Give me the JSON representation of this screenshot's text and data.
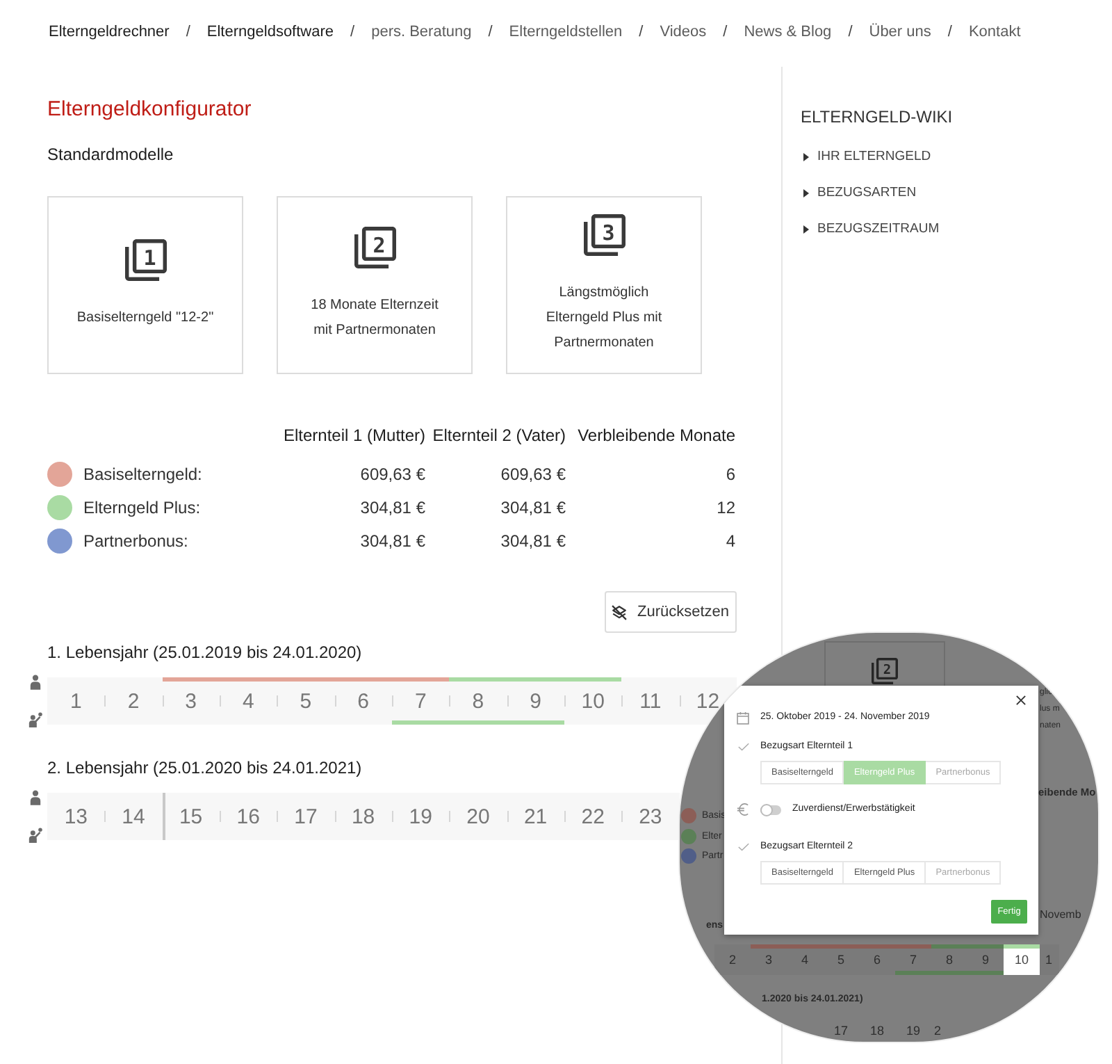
{
  "nav": [
    {
      "label": "Elterngeldrechner",
      "active": true,
      "separator": "/"
    },
    {
      "label": "Elterngeldsoftware",
      "active": true,
      "separator": "/"
    },
    {
      "label": "pers. Beratung",
      "active": false,
      "separator": "/"
    },
    {
      "label": "Elterngeldstellen",
      "active": false,
      "separator": "/"
    },
    {
      "label": "Videos",
      "active": false,
      "separator": "/"
    },
    {
      "label": "News & Blog",
      "active": false,
      "separator": "/"
    },
    {
      "label": "Über uns",
      "active": false,
      "separator": "/"
    },
    {
      "label": "Kontakt",
      "active": false
    }
  ],
  "main": {
    "title": "Elterngeldkonfigurator",
    "subtitle": "Standardmodelle",
    "models": [
      {
        "number": "1",
        "label": "Basiselterngeld \"12-2\""
      },
      {
        "number": "2",
        "label": "18 Monate Elternzeit mit Partnermonaten"
      },
      {
        "number": "3",
        "label": "Längstmöglich Elterngeld Plus mit Partnermonaten"
      }
    ]
  },
  "summary": {
    "columns": [
      "Elternteil 1 (Mutter)",
      "Elternteil 2 (Vater)",
      "Verbleibende Monate"
    ],
    "rows": [
      {
        "kind": "basis",
        "label": "Basiselterngeld:",
        "color": "#e3a598",
        "values": [
          "609,63 €",
          "609,63 €",
          "6"
        ]
      },
      {
        "kind": "plus",
        "label": "Elterngeld Plus:",
        "color": "#a9dba3",
        "values": [
          "304,81 €",
          "304,81 €",
          "12"
        ]
      },
      {
        "kind": "partner",
        "label": "Partnerbonus:",
        "color": "#8098d0",
        "values": [
          "304,81 €",
          "304,81 €",
          "4"
        ]
      }
    ],
    "reset_button": "Zurücksetzen"
  },
  "calendar": [
    {
      "label": "1. Lebensjahr (25.01.2019 bis 24.01.2020)",
      "months": [
        {
          "number": "1",
          "boundary": false
        },
        {
          "number": "2",
          "boundary": false
        },
        {
          "number": "3",
          "mother": {
            "kind": "basis"
          },
          "boundary": false
        },
        {
          "number": "4",
          "mother": {
            "kind": "basis"
          },
          "boundary": false
        },
        {
          "number": "5",
          "mother": {
            "kind": "basis"
          },
          "boundary": false
        },
        {
          "number": "6",
          "mother": {
            "kind": "basis"
          },
          "boundary": false
        },
        {
          "number": "7",
          "mother": {
            "kind": "basis"
          },
          "father": {
            "kind": "plus"
          },
          "boundary": false
        },
        {
          "number": "8",
          "mother": {
            "kind": "plus"
          },
          "father": {
            "kind": "plus"
          },
          "boundary": false
        },
        {
          "number": "9",
          "mother": {
            "kind": "plus"
          },
          "father": {
            "kind": "plus"
          },
          "boundary": false
        },
        {
          "number": "10",
          "mother": {
            "kind": "plus"
          },
          "boundary": false
        },
        {
          "number": "11",
          "boundary": false
        },
        {
          "number": "12",
          "boundary": false
        }
      ]
    },
    {
      "label": "2. Lebensjahr (25.01.2020 bis 24.01.2021)",
      "months": [
        {
          "number": "13",
          "boundary": false
        },
        {
          "number": "14",
          "boundary": false
        },
        {
          "number": "15",
          "boundary": true
        },
        {
          "number": "16",
          "boundary": false
        },
        {
          "number": "17",
          "boundary": false
        },
        {
          "number": "18",
          "boundary": false
        },
        {
          "number": "19",
          "boundary": false
        },
        {
          "number": "20",
          "boundary": false
        },
        {
          "number": "21",
          "boundary": false
        },
        {
          "number": "22",
          "boundary": false
        },
        {
          "number": "23",
          "boundary": false
        }
      ]
    }
  ],
  "sidebar": {
    "title": "ELTERNGELD-WIKI",
    "items": [
      "IHR ELTERNGELD",
      "BEZUGSARTEN",
      "BEZUGSZEITRAUM"
    ]
  },
  "inset": {
    "model_number": "2",
    "card_text": [
      "glic",
      "lus m",
      "naten"
    ],
    "legend": [
      {
        "kind": "basis",
        "label": "Basis",
        "color": "#8c5e57"
      },
      {
        "kind": "plus",
        "label": "Elter",
        "color": "#5b8057"
      },
      {
        "kind": "partner",
        "label": "Partr",
        "color": "#505e88"
      }
    ],
    "column_heading": "eibende Mo",
    "date_fragment": "Novemb",
    "heading_fragment": "ens",
    "months": [
      {
        "number": "2",
        "selected": false
      },
      {
        "number": "3",
        "mother": {
          "kind": "basis"
        },
        "selected": false
      },
      {
        "number": "4",
        "mother": {
          "kind": "basis"
        },
        "selected": false
      },
      {
        "number": "5",
        "mother": {
          "kind": "basis"
        },
        "selected": false
      },
      {
        "number": "6",
        "mother": {
          "kind": "basis"
        },
        "selected": false
      },
      {
        "number": "7",
        "mother": {
          "kind": "basis"
        },
        "father": {
          "kind": "plus"
        },
        "selected": false
      },
      {
        "number": "8",
        "mother": {
          "kind": "plus"
        },
        "father": {
          "kind": "plus"
        },
        "selected": false
      },
      {
        "number": "9",
        "mother": {
          "kind": "plus"
        },
        "father": {
          "kind": "plus"
        },
        "selected": false
      },
      {
        "number": "10",
        "mother": {
          "kind": "plus"
        },
        "selected": true
      },
      {
        "number": "1",
        "selected": false
      }
    ],
    "year_label": "1.2020 bis 24.01.2021)",
    "next_months": [
      "17",
      "18",
      "19",
      "2"
    ],
    "modal": {
      "date": "25. Oktober 2019 - 24. November 2019",
      "sections": [
        {
          "kind": "choice",
          "title": "Bezugsart Elternteil 1",
          "options": [
            {
              "label": "Basiselterngeld",
              "selected": false,
              "disabled": false
            },
            {
              "label": "Elterngeld Plus",
              "selected": true,
              "disabled": false
            },
            {
              "label": "Partnerbonus",
              "selected": false,
              "disabled": true
            }
          ]
        },
        {
          "kind": "toggle",
          "label": "Zuverdienst/Erwerbstätigkeit",
          "on": false
        },
        {
          "kind": "choice",
          "title": "Bezugsart Elternteil 2",
          "options": [
            {
              "label": "Basiselterngeld",
              "selected": false,
              "disabled": false
            },
            {
              "label": "Elterngeld Plus",
              "selected": false,
              "disabled": false
            },
            {
              "label": "Partnerbonus",
              "selected": false,
              "disabled": true
            }
          ]
        }
      ],
      "done_button": "Fertig"
    }
  }
}
